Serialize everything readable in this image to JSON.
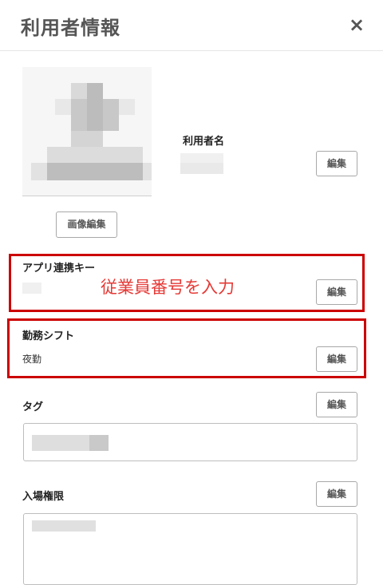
{
  "header": {
    "title": "利用者情報",
    "close_icon": "×"
  },
  "profile": {
    "image_edit_label": "画像編集",
    "user_name_label": "利用者名",
    "edit_label": "編集"
  },
  "app_link_key": {
    "label": "アプリ連携キー",
    "edit_label": "編集",
    "annotation": "従業員番号を入力"
  },
  "shift": {
    "label": "勤務シフト",
    "value": "夜勤",
    "edit_label": "編集"
  },
  "tag": {
    "label": "タグ",
    "edit_label": "編集"
  },
  "access": {
    "label": "入場権限",
    "edit_label": "編集"
  },
  "colors": {
    "highlight_border": "#cc0000",
    "annotation_text": "#e53935"
  }
}
